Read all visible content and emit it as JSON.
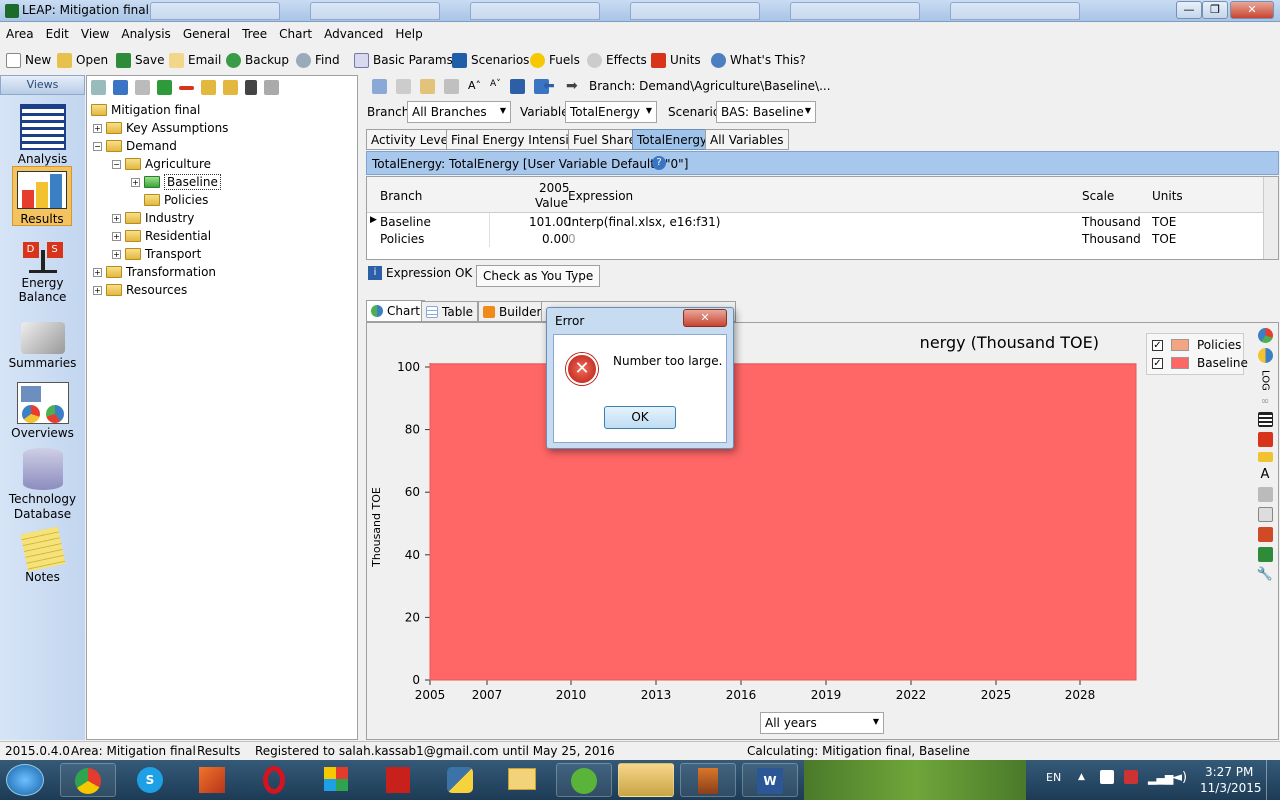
{
  "window": {
    "title": "LEAP: Mitigation final",
    "controls": [
      "—",
      "❐",
      "✕"
    ]
  },
  "menu": [
    "Area",
    "Edit",
    "View",
    "Analysis",
    "General",
    "Tree",
    "Chart",
    "Advanced",
    "Help"
  ],
  "toolbar": {
    "new": "New",
    "open": "Open",
    "save": "Save",
    "email": "Email",
    "backup": "Backup",
    "find": "Find",
    "basic_params": "Basic Params",
    "scenarios": "Scenarios",
    "fuels": "Fuels",
    "effects": "Effects",
    "units": "Units",
    "whats_this": "What's This?"
  },
  "views": {
    "header": "Views",
    "items": [
      {
        "label": "Analysis"
      },
      {
        "label": "Results"
      },
      {
        "label": "Energy Balance"
      },
      {
        "label": "Summaries"
      },
      {
        "label": "Overviews"
      },
      {
        "label": "Technology Database"
      },
      {
        "label": "Notes"
      }
    ]
  },
  "tree": {
    "root": "Mitigation final",
    "items": [
      {
        "label": "Key Assumptions"
      },
      {
        "label": "Demand"
      },
      {
        "label": "Agriculture"
      },
      {
        "label": "Baseline"
      },
      {
        "label": "Policies"
      },
      {
        "label": "Industry"
      },
      {
        "label": "Residential"
      },
      {
        "label": "Transport"
      },
      {
        "label": "Transformation"
      },
      {
        "label": "Resources"
      }
    ]
  },
  "branch_path": "Branch: Demand\\Agriculture\\Baseline\\...",
  "filters": {
    "branch_label": "Branch:",
    "branch_value": "All Branches",
    "variable_label": "Variable:",
    "variable_value": "TotalEnergy",
    "scenario_label": "Scenario:",
    "scenario_value": "BAS: Baseline"
  },
  "var_tabs": [
    "Activity Level",
    "Final Energy Intensity",
    "Fuel Share",
    "TotalEnergy",
    "All Variables"
  ],
  "variable_desc": "TotalEnergy: TotalEnergy [User Variable Default=\"0\"]",
  "grid": {
    "headers": {
      "branch": "Branch",
      "year": "2005",
      "value": "Value",
      "expression": "Expression",
      "scale": "Scale",
      "units": "Units"
    },
    "rows": [
      {
        "branch": "Baseline",
        "value": "101.00",
        "expression": "Interp(final.xlsx, e16:f31)",
        "scale": "Thousand",
        "units": "TOE"
      },
      {
        "branch": "Policies",
        "value": "0.00",
        "expression": "0",
        "scale": "Thousand",
        "units": "TOE"
      }
    ]
  },
  "expr_status": {
    "ok": "Expression OK",
    "check": "Check as You Type"
  },
  "chart_tabs": [
    "Chart",
    "Table",
    "Builder"
  ],
  "chart_data": {
    "type": "area",
    "title": "nergy (Thousand TOE)",
    "ylabel": "Thousand TOE",
    "ylim": [
      0,
      100
    ],
    "yticks": [
      0,
      20,
      40,
      60,
      80,
      100
    ],
    "xticks": [
      "2005",
      "2007",
      "2010",
      "2013",
      "2016",
      "2019",
      "2022",
      "2025",
      "2028"
    ],
    "series": [
      {
        "name": "Policies",
        "color": "#f4a480",
        "values": [
          0,
          0,
          0,
          0,
          0,
          0,
          0,
          0,
          0
        ]
      },
      {
        "name": "Baseline",
        "color": "#ff6666",
        "values": [
          101,
          101,
          101,
          101,
          101,
          101,
          101,
          101,
          101
        ]
      }
    ]
  },
  "chart_years": "All years",
  "error_dialog": {
    "title": "Error",
    "message": "Number too large.",
    "ok": "OK"
  },
  "status": {
    "version": "2015.0.4.0",
    "area": "Area: Mitigation final",
    "view": "Results",
    "registered": "Registered to salah.kassab1@gmail.com until May 25, 2016",
    "calculating": "Calculating: Mitigation final, Baseline"
  },
  "tray": {
    "lang": "EN",
    "time": "3:27 PM",
    "date": "11/3/2015"
  },
  "log_label": "LOG"
}
